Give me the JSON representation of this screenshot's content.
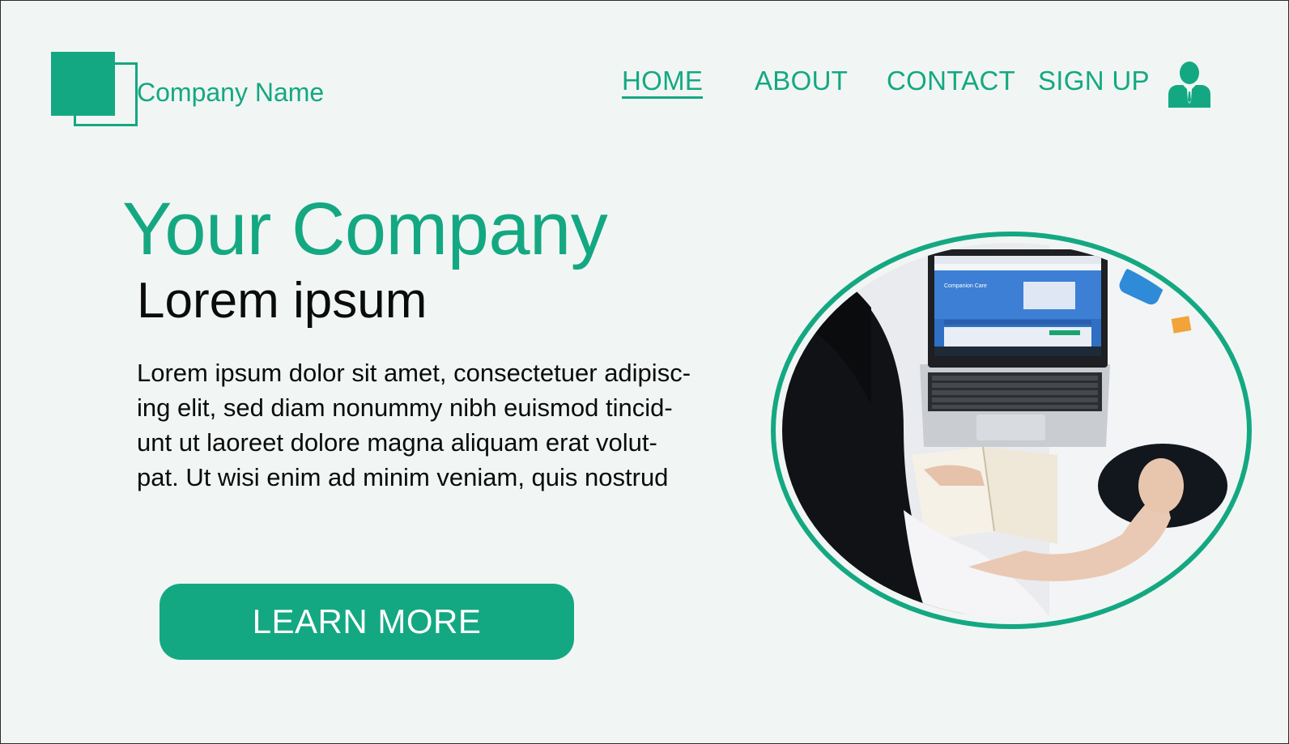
{
  "brand": {
    "name": "Company Name",
    "accent_color": "#14a882",
    "text_color": "#0b0b0b"
  },
  "nav": {
    "items": [
      {
        "label": "HOME",
        "active": true
      },
      {
        "label": "ABOUT",
        "active": false
      },
      {
        "label": "CONTACT",
        "active": false
      },
      {
        "label": "SIGN UP",
        "active": false
      }
    ],
    "account_icon": "user-icon"
  },
  "hero": {
    "title": "Your Company",
    "subtitle": "Lorem ipsum",
    "body_lines": [
      "Lorem ipsum dolor sit amet, consectetuer adipisc-",
      "ing elit, sed diam nonummy nibh euismod tincid-",
      "unt ut laoreet dolore magna aliquam erat volut-",
      "pat. Ut wisi enim ad minim veniam, quis nostrud"
    ],
    "cta_label": "LEARN MORE"
  },
  "photo": {
    "screen_heading": "Companion Care"
  }
}
